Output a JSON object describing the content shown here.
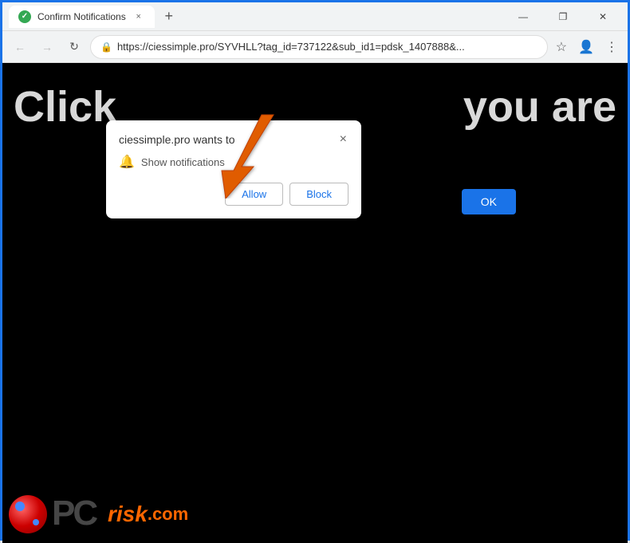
{
  "title_bar": {
    "tab_title": "Confirm Notifications",
    "close_tab_label": "×",
    "new_tab_label": "+",
    "minimize_label": "—",
    "maximize_label": "❐",
    "close_window_label": "✕"
  },
  "address_bar": {
    "back_label": "←",
    "forward_label": "→",
    "reload_label": "↻",
    "url": "https://ciessimple.pro/SYVHLL?tag_id=737122&sub_id1=pdsk_1407888&...",
    "bookmark_label": "☆",
    "profile_label": "👤",
    "menu_label": "⋮"
  },
  "notification_dialog": {
    "title": "ciessimple.pro wants to",
    "close_label": "×",
    "notification_text": "Show notifications",
    "allow_label": "Allow",
    "block_label": "Block"
  },
  "page": {
    "text_left": "Click",
    "text_right": "you are",
    "ok_label": "OK"
  },
  "pcrisk": {
    "pc_text": "PC",
    "risk_text": "risk",
    "com_text": ".com"
  },
  "colors": {
    "accent": "#1a73e8",
    "orange": "#ff6600",
    "arrow": "#e05c00"
  }
}
